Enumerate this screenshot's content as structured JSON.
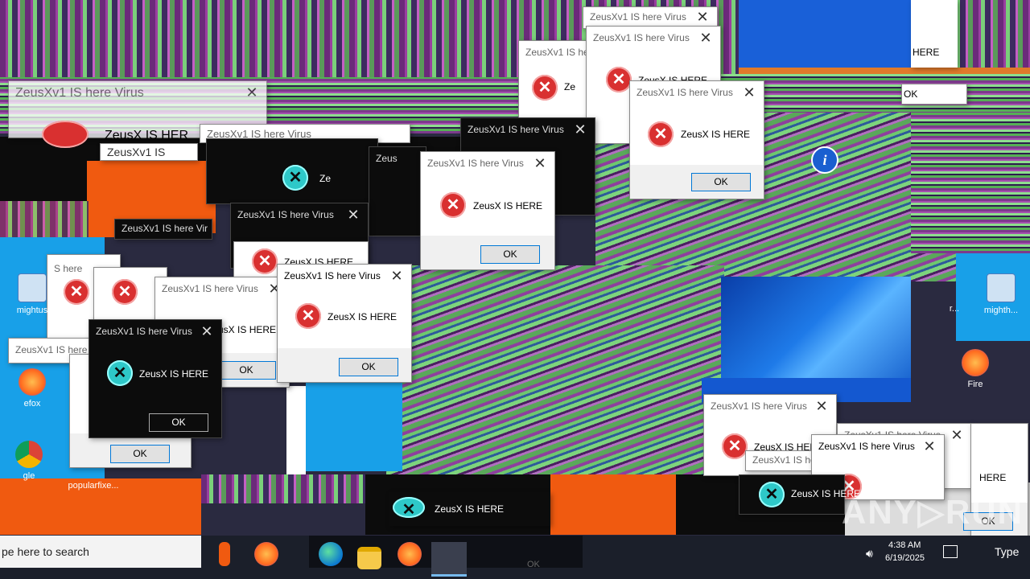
{
  "dialog": {
    "title": "ZeusXv1 IS here Virus",
    "title_short": "ZeusXv1 IS he",
    "title_frag": "Zeus",
    "title_frag2": "ZeusXv1 IS",
    "title_frag3": "ZeusXv1 IS here Vir",
    "message": "ZeusX IS HERE",
    "message_short": "Ze",
    "message_frag": "HERE",
    "ok_label": "OK",
    "close_glyph": "✕",
    "error_icon": "error-x-icon"
  },
  "desktop": {
    "icons": [
      {
        "label": "mightus"
      },
      {
        "label": "efox"
      },
      {
        "label": "gle"
      },
      {
        "label": "popularfixe..."
      },
      {
        "label": "Fire"
      },
      {
        "label": "mighth..."
      },
      {
        "label": "r..."
      }
    ]
  },
  "glitch_texts": {
    "virus_big": "ZeusXv1 IS here Virus",
    "zeus_big": "ZeusX IS HER",
    "zeus_banner": "ZeusX IS HERE",
    "here": "HERE",
    "ok_frag": "OK",
    "here_frag": "S here"
  },
  "taskbar": {
    "search_placeholder": "pe here to search",
    "time": "4:38 AM",
    "date": "6/19/2025",
    "type_label": "Type",
    "ok_ghost": "OK"
  },
  "watermark": "ANY▷RUN",
  "colors": {
    "accent": "#0078d7",
    "error_red": "#d93030",
    "glitch_purple": "#7c3a8c",
    "glitch_green": "#6ec86e"
  }
}
